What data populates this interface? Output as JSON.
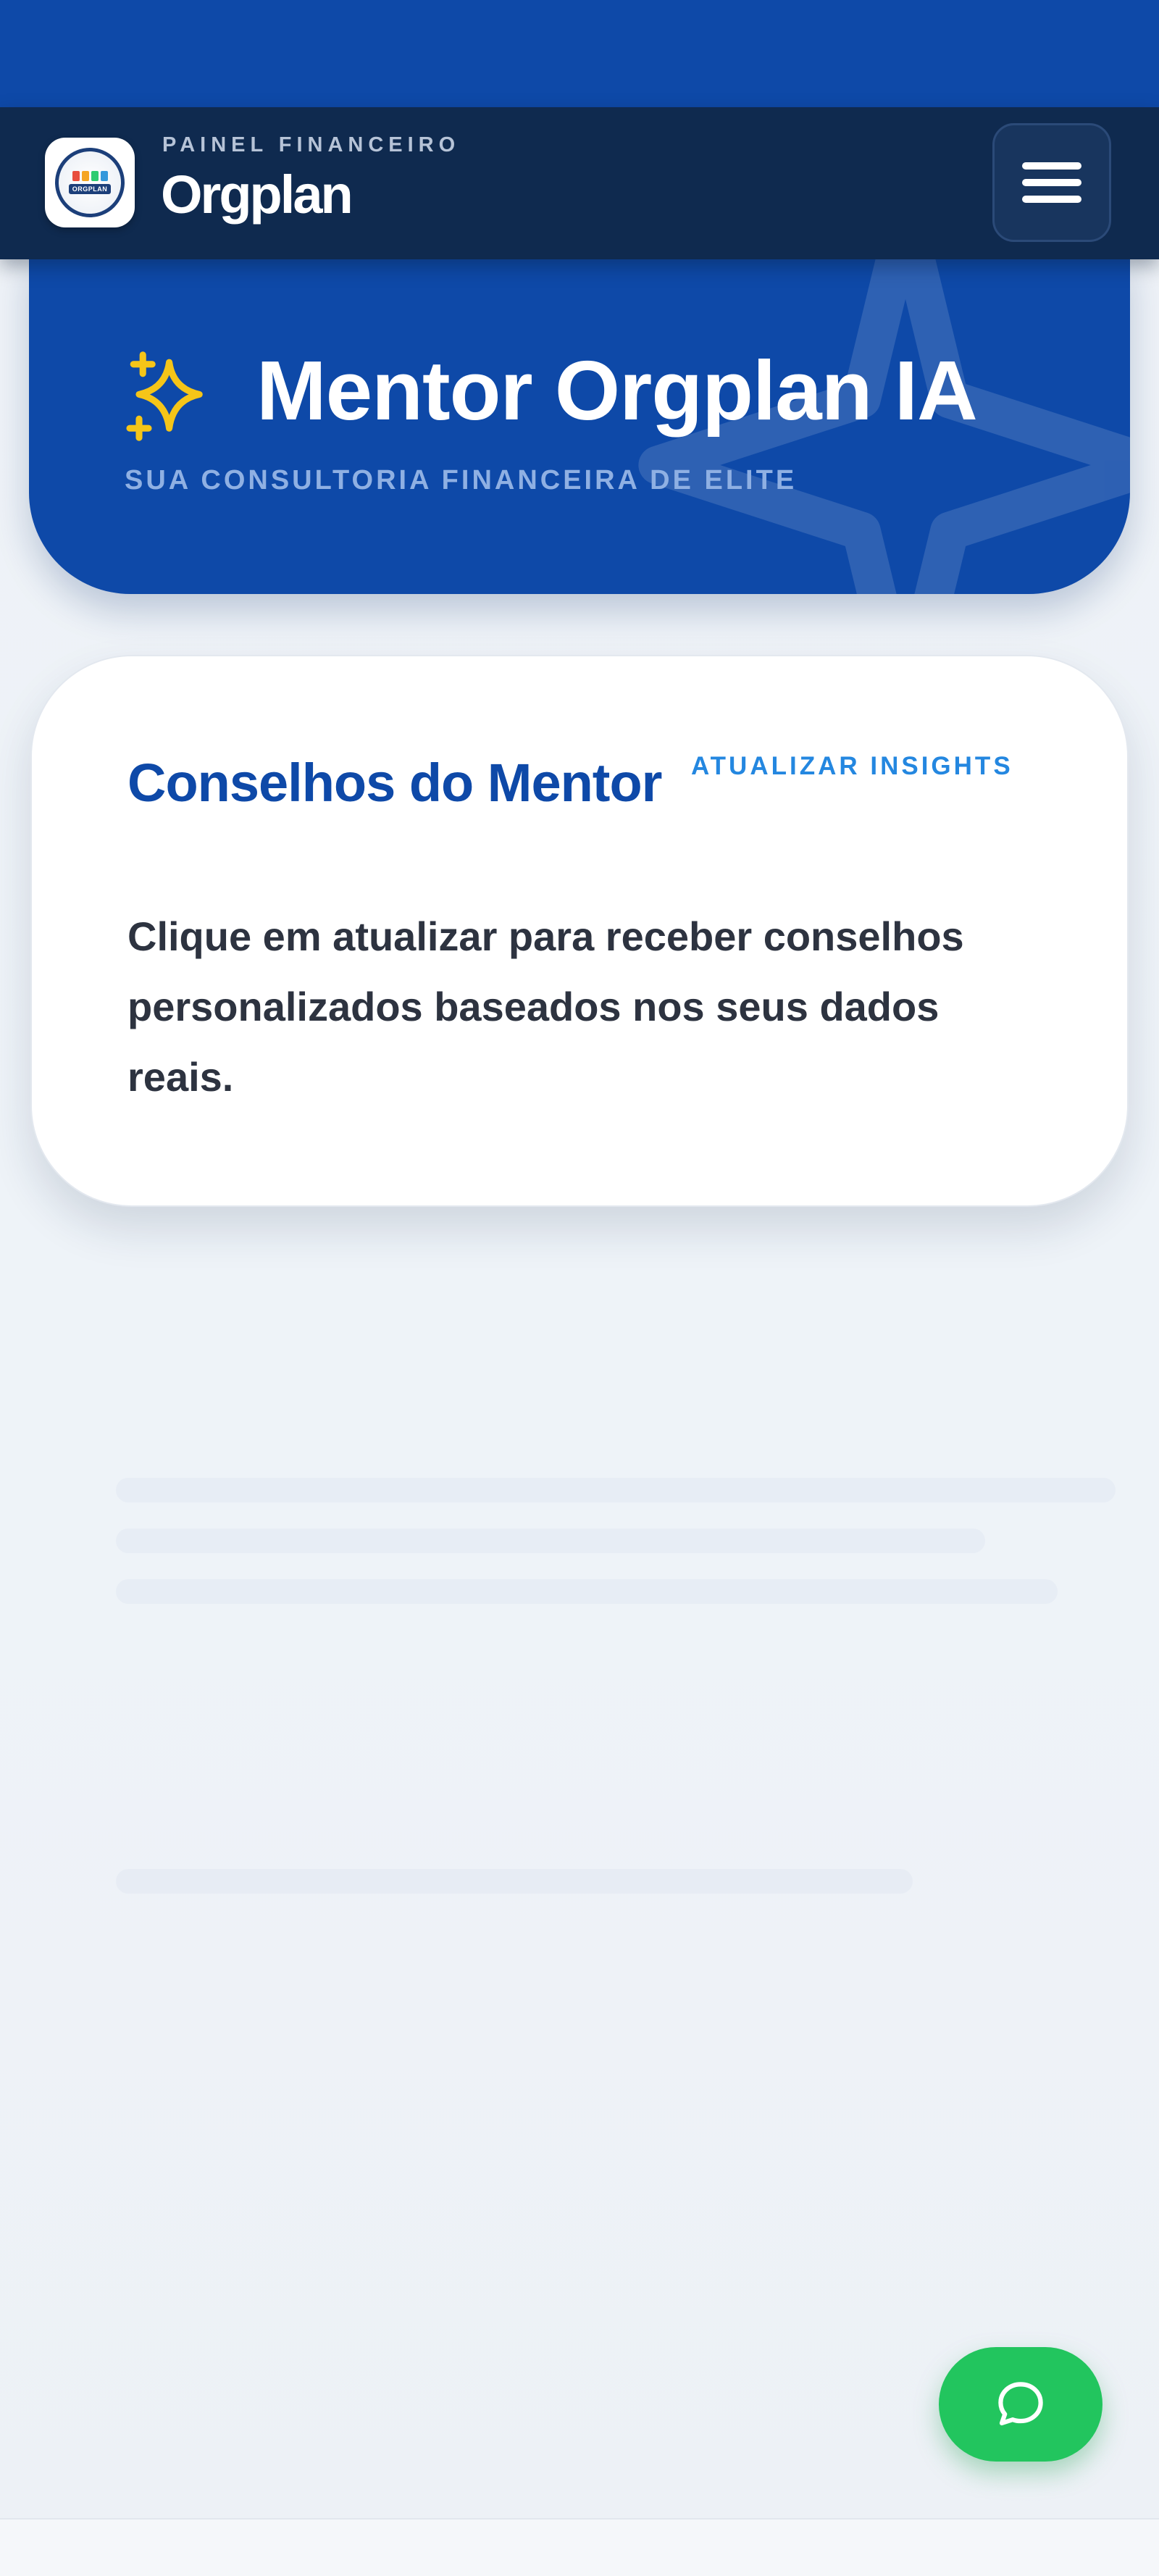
{
  "header": {
    "overline": "PAINEL FINANCEIRO",
    "brand": "Orgplan",
    "logo_text": "ORGPLAN",
    "menu_icon": "hamburger-menu-icon"
  },
  "hero": {
    "icon": "sparkles-icon",
    "title": "Mentor Orgplan IA",
    "subtitle": "SUA CONSULTORIA FINANCEIRA DE ELITE"
  },
  "advice": {
    "title": "Conselhos do Mentor",
    "refresh_label": "ATUALIZAR INSIGHTS",
    "message": "Clique em atualizar para receber conselhos personalizados baseados nos seus dados reais."
  },
  "chat": {
    "icon": "chat-bubble-icon"
  },
  "colors": {
    "primary": "#0e49a8",
    "header": "#0f2a4f",
    "accent": "#2487e0",
    "sparkle": "#f5c518",
    "chat": "#22c55e"
  }
}
